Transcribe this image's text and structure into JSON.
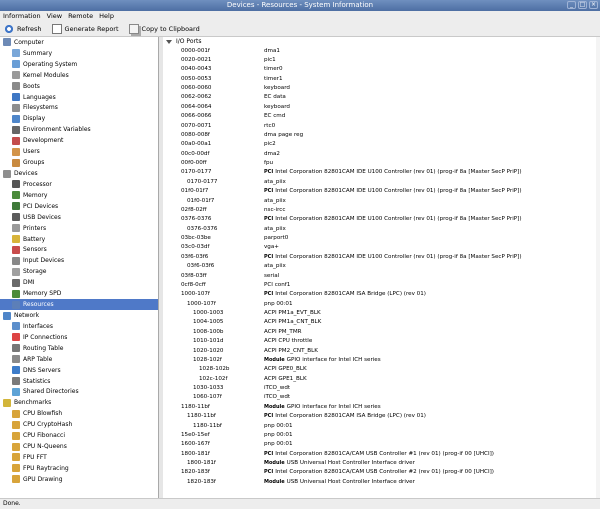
{
  "window": {
    "title": "Devices - Resources - System Information"
  },
  "menu": [
    "Information",
    "View",
    "Remote",
    "Help"
  ],
  "toolbar": {
    "refresh": "Refresh",
    "report": "Generate Report",
    "copy": "Copy to Clipboard"
  },
  "tree": [
    {
      "label": "Computer",
      "level": 0,
      "color": "#6d8ab6"
    },
    {
      "label": "Summary",
      "level": 1,
      "color": "#7aa7d8"
    },
    {
      "label": "Operating System",
      "level": 1,
      "color": "#6a9ed6"
    },
    {
      "label": "Kernel Modules",
      "level": 1,
      "color": "#9a9a9a"
    },
    {
      "label": "Boots",
      "level": 1,
      "color": "#8a8a8a"
    },
    {
      "label": "Languages",
      "level": 1,
      "color": "#3e77c4"
    },
    {
      "label": "Filesystems",
      "level": 1,
      "color": "#8e8e8e"
    },
    {
      "label": "Display",
      "level": 1,
      "color": "#4f86c9"
    },
    {
      "label": "Environment Variables",
      "level": 1,
      "color": "#666666"
    },
    {
      "label": "Development",
      "level": 1,
      "color": "#c44d4d"
    },
    {
      "label": "Users",
      "level": 1,
      "color": "#d3944a"
    },
    {
      "label": "Groups",
      "level": 1,
      "color": "#c98a3f"
    },
    {
      "label": "Devices",
      "level": 0,
      "color": "#8e8e8e"
    },
    {
      "label": "Processor",
      "level": 1,
      "color": "#555555"
    },
    {
      "label": "Memory",
      "level": 1,
      "color": "#4b8b3b"
    },
    {
      "label": "PCI Devices",
      "level": 1,
      "color": "#3f7a3a"
    },
    {
      "label": "USB Devices",
      "level": 1,
      "color": "#5b5b5b"
    },
    {
      "label": "Printers",
      "level": 1,
      "color": "#9a9a9a"
    },
    {
      "label": "Battery",
      "level": 1,
      "color": "#d8b43a"
    },
    {
      "label": "Sensors",
      "level": 1,
      "color": "#c84c4c"
    },
    {
      "label": "Input Devices",
      "level": 1,
      "color": "#888888"
    },
    {
      "label": "Storage",
      "level": 1,
      "color": "#a0a0a0"
    },
    {
      "label": "DMI",
      "level": 1,
      "color": "#6a6a6a"
    },
    {
      "label": "Memory SPD",
      "level": 1,
      "color": "#4b8b3b"
    },
    {
      "label": "Resources",
      "level": 1,
      "color": "#5c7fb8",
      "selected": true
    },
    {
      "label": "Network",
      "level": 0,
      "color": "#4f86c9"
    },
    {
      "label": "Interfaces",
      "level": 1,
      "color": "#5c8fcc"
    },
    {
      "label": "IP Connections",
      "level": 1,
      "color": "#d44"
    },
    {
      "label": "Routing Table",
      "level": 1,
      "color": "#777777"
    },
    {
      "label": "ARP Table",
      "level": 1,
      "color": "#8a8a8a"
    },
    {
      "label": "DNS Servers",
      "level": 1,
      "color": "#3d7cc9"
    },
    {
      "label": "Statistics",
      "level": 1,
      "color": "#7a7a7a"
    },
    {
      "label": "Shared Directories",
      "level": 1,
      "color": "#5ea3d6"
    },
    {
      "label": "Benchmarks",
      "level": 0,
      "color": "#d2b53a"
    },
    {
      "label": "CPU Blowfish",
      "level": 1,
      "color": "#d8a43a"
    },
    {
      "label": "CPU CryptoHash",
      "level": 1,
      "color": "#d8a43a"
    },
    {
      "label": "CPU Fibonacci",
      "level": 1,
      "color": "#d8a43a"
    },
    {
      "label": "CPU N-Queens",
      "level": 1,
      "color": "#d8a43a"
    },
    {
      "label": "FPU FFT",
      "level": 1,
      "color": "#d8a43a"
    },
    {
      "label": "FPU Raytracing",
      "level": 1,
      "color": "#d8a43a"
    },
    {
      "label": "GPU Drawing",
      "level": 1,
      "color": "#d8a43a"
    }
  ],
  "main": {
    "section": "I/O Ports",
    "rows": [
      {
        "range": "0000-001f",
        "desc": "dma1",
        "indent": 0
      },
      {
        "range": "0020-0021",
        "desc": "pic1",
        "indent": 0
      },
      {
        "range": "0040-0043",
        "desc": "timer0",
        "indent": 0
      },
      {
        "range": "0050-0053",
        "desc": "timer1",
        "indent": 0
      },
      {
        "range": "0060-0060",
        "desc": "keyboard",
        "indent": 0
      },
      {
        "range": "0062-0062",
        "desc": "EC data",
        "indent": 0
      },
      {
        "range": "0064-0064",
        "desc": "keyboard",
        "indent": 0
      },
      {
        "range": "0066-0066",
        "desc": "EC cmd",
        "indent": 0
      },
      {
        "range": "0070-0071",
        "desc": "rtc0",
        "indent": 0
      },
      {
        "range": "0080-008f",
        "desc": "dma page reg",
        "indent": 0
      },
      {
        "range": "00a0-00a1",
        "desc": "pic2",
        "indent": 0
      },
      {
        "range": "00c0-00df",
        "desc": "dma2",
        "indent": 0
      },
      {
        "range": "00f0-00ff",
        "desc": "fpu",
        "indent": 0
      },
      {
        "range": "0170-0177",
        "tag": "PCI",
        "desc": "Intel Corporation 82801CAM IDE U100 Controller (rev 01) (prog-if 8a [Master SecP PriP])",
        "indent": 0
      },
      {
        "range": "0170-0177",
        "desc": "ata_piix",
        "indent": 1
      },
      {
        "range": "01f0-01f7",
        "tag": "PCI",
        "desc": "Intel Corporation 82801CAM IDE U100 Controller (rev 01) (prog-if 8a [Master SecP PriP])",
        "indent": 0
      },
      {
        "range": "01f0-01f7",
        "desc": "ata_piix",
        "indent": 1
      },
      {
        "range": "02f8-02ff",
        "desc": "nsc-ircc",
        "indent": 0
      },
      {
        "range": "0376-0376",
        "tag": "PCI",
        "desc": "Intel Corporation 82801CAM IDE U100 Controller (rev 01) (prog-if 8a [Master SecP PriP])",
        "indent": 0
      },
      {
        "range": "0376-0376",
        "desc": "ata_piix",
        "indent": 1
      },
      {
        "range": "03bc-03be",
        "desc": "parport0",
        "indent": 0
      },
      {
        "range": "03c0-03df",
        "desc": "vga+",
        "indent": 0
      },
      {
        "range": "03f6-03f6",
        "tag": "PCI",
        "desc": "Intel Corporation 82801CAM IDE U100 Controller (rev 01) (prog-if 8a [Master SecP PriP])",
        "indent": 0
      },
      {
        "range": "03f6-03f6",
        "desc": "ata_piix",
        "indent": 1
      },
      {
        "range": "03f8-03ff",
        "desc": "serial",
        "indent": 0
      },
      {
        "range": "0cf8-0cff",
        "desc": "PCI conf1",
        "indent": 0
      },
      {
        "range": "1000-107f",
        "tag": "PCI",
        "desc": "Intel Corporation 82801CAM ISA Bridge (LPC) (rev 01)",
        "indent": 0
      },
      {
        "range": "1000-107f",
        "desc": "pnp 00:01",
        "indent": 1
      },
      {
        "range": "1000-1003",
        "desc": "ACPI PM1a_EVT_BLK",
        "indent": 2
      },
      {
        "range": "1004-1005",
        "desc": "ACPI PM1a_CNT_BLK",
        "indent": 2
      },
      {
        "range": "1008-100b",
        "desc": "ACPI PM_TMR",
        "indent": 2
      },
      {
        "range": "1010-101d",
        "desc": "ACPI CPU throttle",
        "indent": 2
      },
      {
        "range": "1020-1020",
        "desc": "ACPI PM2_CNT_BLK",
        "indent": 2
      },
      {
        "range": "1028-102f",
        "tag": "Module",
        "desc": "GPIO interface for Intel ICH series",
        "indent": 2
      },
      {
        "range": "1028-102b",
        "desc": "ACPI GPE0_BLK",
        "indent": 3
      },
      {
        "range": "102c-102f",
        "desc": "ACPI GPE1_BLK",
        "indent": 3
      },
      {
        "range": "1030-1033",
        "desc": "iTCO_wdt",
        "indent": 2
      },
      {
        "range": "1060-107f",
        "desc": "iTCO_wdt",
        "indent": 2
      },
      {
        "range": "1180-11bf",
        "tag": "Module",
        "desc": "GPIO interface for Intel ICH series",
        "indent": 0
      },
      {
        "range": "1180-11bf",
        "tag": "PCI",
        "desc": "Intel Corporation 82801CAM ISA Bridge (LPC) (rev 01)",
        "indent": 1
      },
      {
        "range": "1180-11bf",
        "desc": "pnp 00:01",
        "indent": 2
      },
      {
        "range": "15e0-15ef",
        "desc": "pnp 00:01",
        "indent": 0
      },
      {
        "range": "1600-167f",
        "desc": "pnp 00:01",
        "indent": 0
      },
      {
        "range": "1800-181f",
        "tag": "PCI",
        "desc": "Intel Corporation 82801CA/CAM USB Controller #1 (rev 01) (prog-if 00 [UHCI])",
        "indent": 0
      },
      {
        "range": "1800-181f",
        "tag": "Module",
        "desc": "USB Universal Host Controller Interface driver",
        "indent": 1
      },
      {
        "range": "1820-183f",
        "tag": "PCI",
        "desc": "Intel Corporation 82801CA/CAM USB Controller #2 (rev 01) (prog-if 00 [UHCI])",
        "indent": 0
      },
      {
        "range": "1820-183f",
        "tag": "Module",
        "desc": "USB Universal Host Controller Interface driver",
        "indent": 1
      }
    ]
  },
  "status": "Done."
}
